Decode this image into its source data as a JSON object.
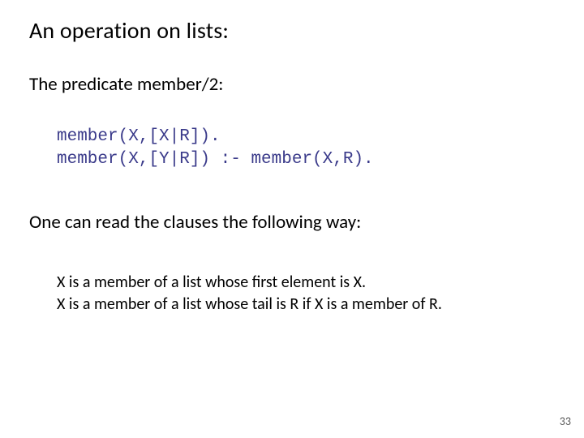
{
  "title": "An operation on lists:",
  "subtitle": "The predicate member/2:",
  "code": {
    "line1": "member(X,[X|R]).",
    "line2": "member(X,[Y|R]) :- member(X,R)."
  },
  "reading": "One can read the clauses the following way:",
  "explain": {
    "line1": "X is a member of a list whose first element is X.",
    "line2": "X is a member of a list whose tail is R if X is a member of R."
  },
  "page_number": "33"
}
